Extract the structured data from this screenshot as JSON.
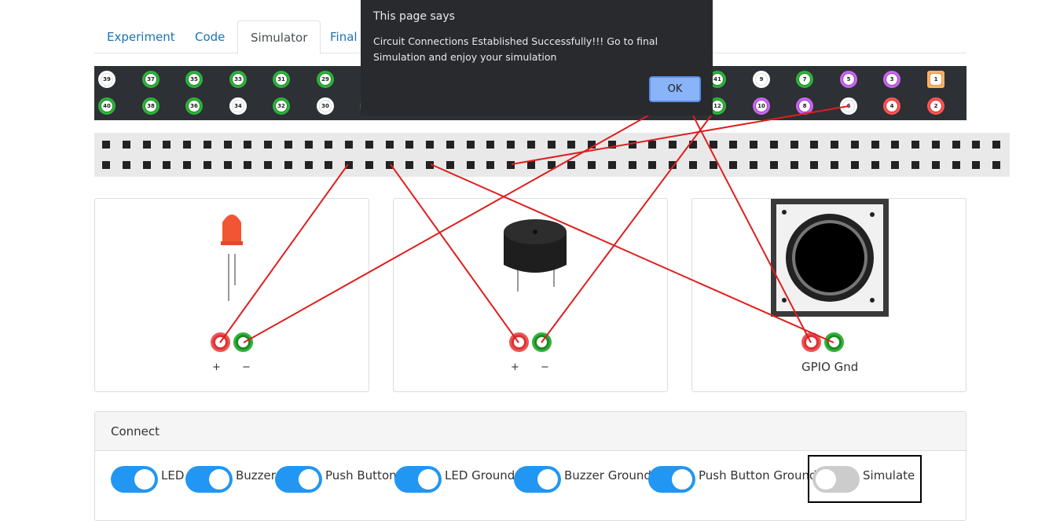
{
  "tabs": [
    {
      "label": "Experiment",
      "active": false
    },
    {
      "label": "Code",
      "active": false
    },
    {
      "label": "Simulator",
      "active": true
    },
    {
      "label": "Final",
      "active": false
    }
  ],
  "pin_header": {
    "top_row": [
      {
        "n": "39",
        "color": "white"
      },
      {
        "n": "37",
        "color": "green"
      },
      {
        "n": "35",
        "color": "green"
      },
      {
        "n": "33",
        "color": "green"
      },
      {
        "n": "31",
        "color": "green"
      },
      {
        "n": "29",
        "color": "green"
      },
      {
        "n": "41",
        "color": "green"
      },
      {
        "n": "9",
        "color": "white"
      },
      {
        "n": "7",
        "color": "green"
      },
      {
        "n": "5",
        "color": "purple"
      },
      {
        "n": "3",
        "color": "purple"
      },
      {
        "n": "1",
        "color": "orange"
      }
    ],
    "bottom_row": [
      {
        "n": "40",
        "color": "green"
      },
      {
        "n": "38",
        "color": "green"
      },
      {
        "n": "36",
        "color": "green"
      },
      {
        "n": "34",
        "color": "white"
      },
      {
        "n": "32",
        "color": "green"
      },
      {
        "n": "30",
        "color": "white"
      },
      {
        "n": "12",
        "color": "green"
      },
      {
        "n": "10",
        "color": "purple"
      },
      {
        "n": "8",
        "color": "purple"
      },
      {
        "n": "6",
        "color": "white"
      },
      {
        "n": "4",
        "color": "red"
      },
      {
        "n": "2",
        "color": "red"
      }
    ]
  },
  "components": {
    "led": {
      "plus_label": "+",
      "minus_label": "−"
    },
    "buzzer": {
      "plus_label": "+",
      "minus_label": "−"
    },
    "push_button": {
      "label": "GPIO Gnd"
    }
  },
  "connect": {
    "title": "Connect",
    "toggles": [
      {
        "label": "LED",
        "on": true
      },
      {
        "label": "Buzzer",
        "on": true
      },
      {
        "label": "Push Button",
        "on": true
      },
      {
        "label": "LED Ground",
        "on": true
      },
      {
        "label": "Buzzer Ground",
        "on": true
      },
      {
        "label": "Push Button Ground",
        "on": true
      },
      {
        "label": "Simulate",
        "on": false
      }
    ]
  },
  "dialog": {
    "title": "This page says",
    "message": "Circuit Connections Established Successfully!!! Go to final Simulation and enjoy your simulation",
    "ok_label": "OK"
  },
  "colors": {
    "toggle_on": "#2196f3",
    "toggle_off": "#cccccc",
    "wire": "#e01e1e",
    "dialog_bg": "#292a2d",
    "dialog_button": "#8ab4f8"
  }
}
